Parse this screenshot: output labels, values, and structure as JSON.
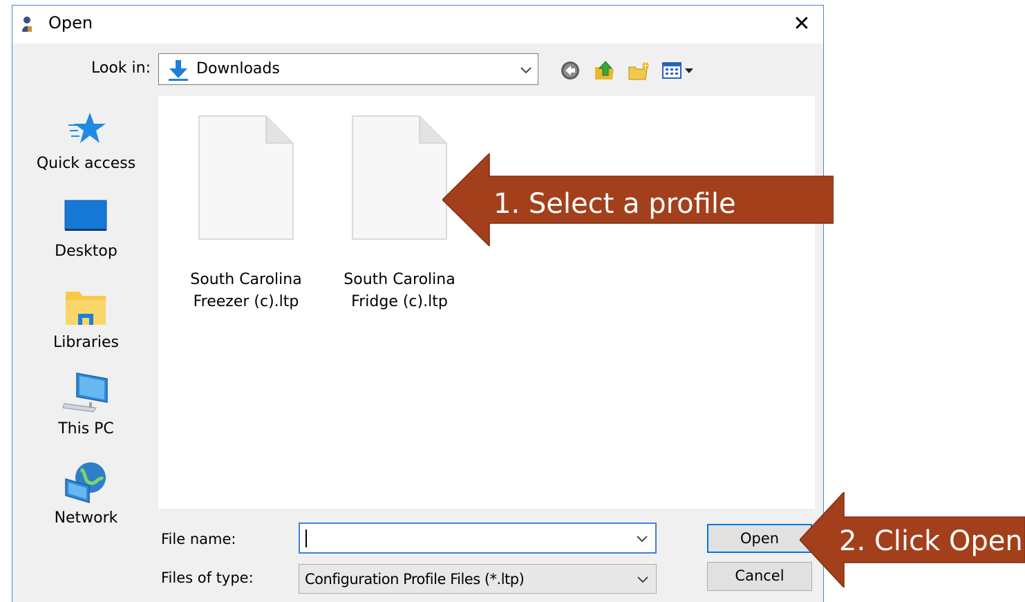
{
  "window": {
    "title": "Open",
    "close_glyph": "✕"
  },
  "toolbar": {
    "look_in_label": "Look in:",
    "look_in_value": "Downloads",
    "buttons": [
      "back-icon",
      "up-folder-icon",
      "new-folder-icon",
      "view-menu-icon"
    ]
  },
  "places": [
    {
      "label": "Quick access",
      "icon": "star-icon"
    },
    {
      "label": "Desktop",
      "icon": "desktop-icon"
    },
    {
      "label": "Libraries",
      "icon": "libraries-icon"
    },
    {
      "label": "This PC",
      "icon": "computer-icon"
    },
    {
      "label": "Network",
      "icon": "network-icon"
    }
  ],
  "files": [
    {
      "name": "South Carolina\nFreezer (c).ltp"
    },
    {
      "name": "South Carolina\nFridge (c).ltp"
    }
  ],
  "form": {
    "file_name_label": "File name:",
    "file_name_value": "",
    "file_type_label": "Files of type:",
    "file_type_value": "Configuration Profile Files (*.ltp)"
  },
  "buttons": {
    "open": "Open",
    "cancel": "Cancel"
  },
  "callouts": [
    {
      "text": "1. Select a profile"
    },
    {
      "text": "2. Click Open"
    }
  ],
  "colors": {
    "callout": "#a3401b",
    "accent": "#0078d7",
    "folder_blue": "#1e7fd9"
  }
}
